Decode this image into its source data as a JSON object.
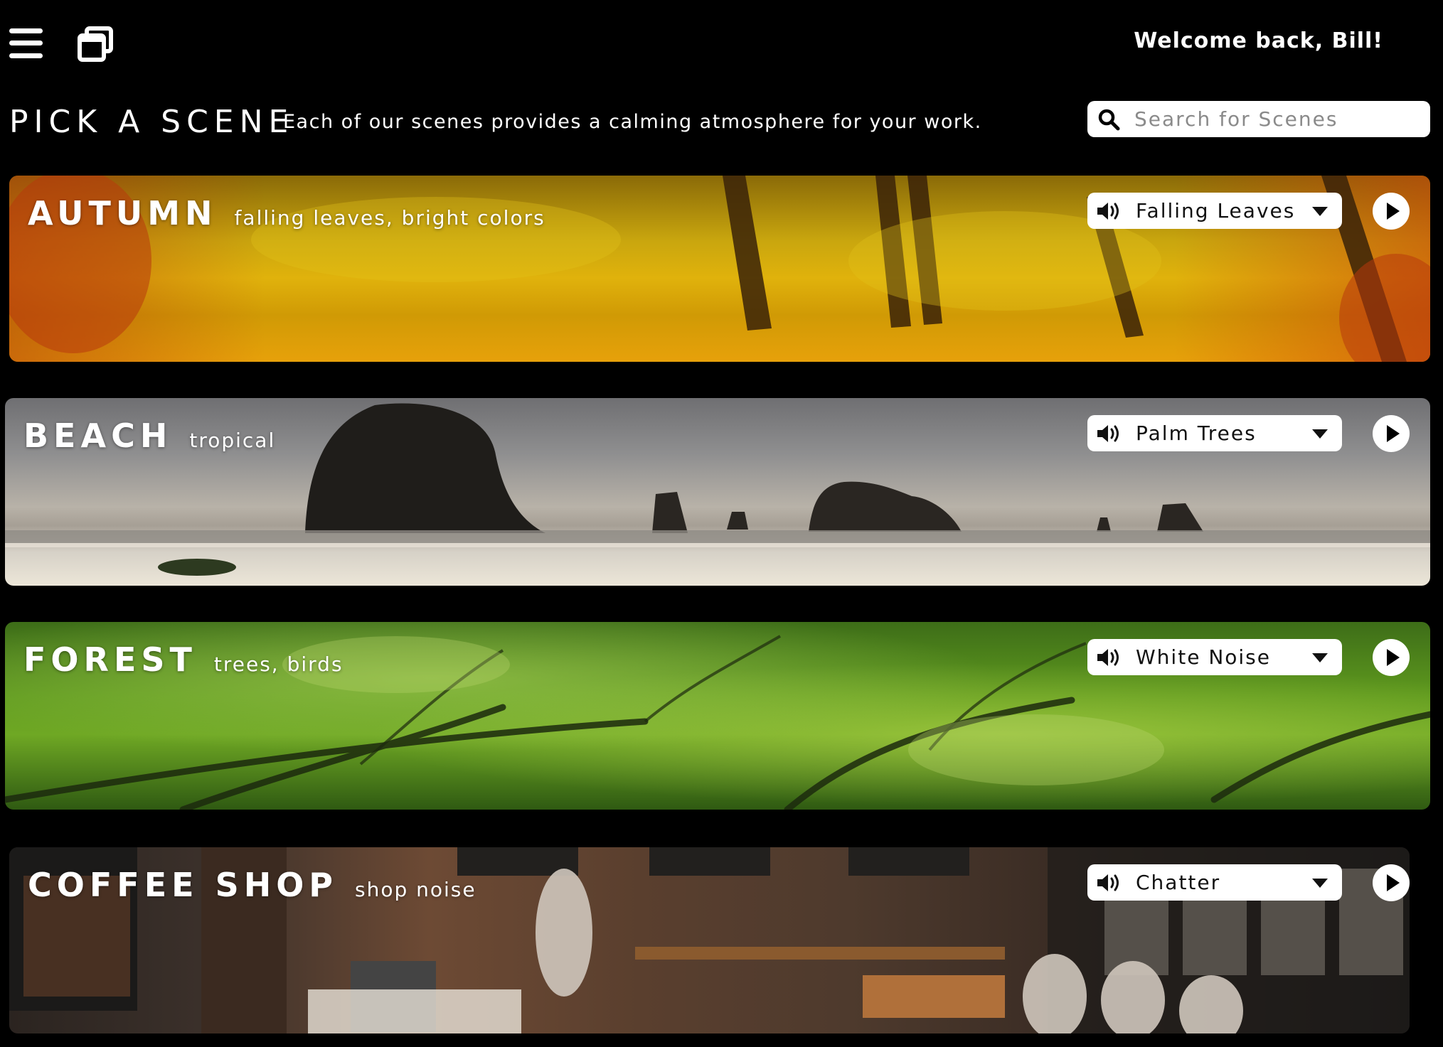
{
  "header": {
    "menu_icon": "hamburger-menu-icon",
    "windows_icon": "windows-icon",
    "welcome": "Welcome back, Bill!"
  },
  "intro": {
    "title": "PICK A SCENE",
    "subtitle": "Each of our scenes provides a calming atmosphere for your work."
  },
  "search": {
    "icon": "search-icon",
    "placeholder": "Search for Scenes",
    "value": ""
  },
  "scenes": [
    {
      "title": "AUTUMN",
      "description": "falling leaves, bright colors",
      "sound": "Falling Leaves",
      "speaker_icon": "speaker-icon",
      "play_icon": "play-icon"
    },
    {
      "title": "BEACH",
      "description": "tropical",
      "sound": "Palm Trees",
      "speaker_icon": "speaker-icon",
      "play_icon": "play-icon"
    },
    {
      "title": "FOREST",
      "description": "trees, birds",
      "sound": "White Noise",
      "speaker_icon": "speaker-icon",
      "play_icon": "play-icon"
    },
    {
      "title": "COFFEE SHOP",
      "description": "shop noise",
      "sound": "Chatter",
      "speaker_icon": "speaker-icon",
      "play_icon": "play-icon"
    }
  ],
  "colors": {
    "background": "#000000",
    "control_bg": "#ffffff",
    "text": "#ffffff"
  }
}
